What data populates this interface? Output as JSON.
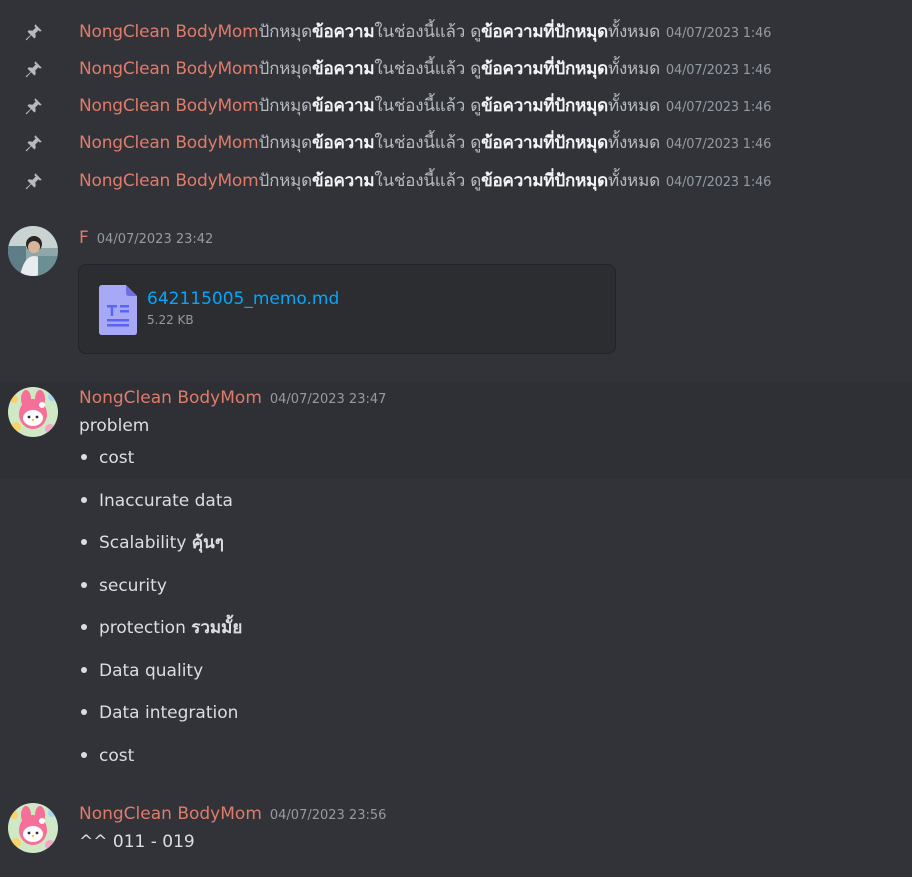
{
  "pins": [
    {
      "author": "NongClean BodyMom",
      "a": "ปักหมุด",
      "b": "ข้อความ",
      "c": "ในช่องนี้แล้ว ดู",
      "d": "ข้อความที่ปักหมุด",
      "e": "ทั้งหมด",
      "time": "04/07/2023 1:46"
    },
    {
      "author": "NongClean BodyMom",
      "a": "ปักหมุด",
      "b": "ข้อความ",
      "c": "ในช่องนี้แล้ว ดู",
      "d": "ข้อความที่ปักหมุด",
      "e": "ทั้งหมด",
      "time": "04/07/2023 1:46"
    },
    {
      "author": "NongClean BodyMom",
      "a": "ปักหมุด",
      "b": "ข้อความ",
      "c": "ในช่องนี้แล้ว ดู",
      "d": "ข้อความที่ปักหมุด",
      "e": "ทั้งหมด",
      "time": "04/07/2023 1:46"
    },
    {
      "author": "NongClean BodyMom",
      "a": "ปักหมุด",
      "b": "ข้อความ",
      "c": "ในช่องนี้แล้ว ดู",
      "d": "ข้อความที่ปักหมุด",
      "e": "ทั้งหมด",
      "time": "04/07/2023 1:46"
    },
    {
      "author": "NongClean BodyMom",
      "a": "ปักหมุด",
      "b": "ข้อความ",
      "c": "ในช่องนี้แล้ว ดู",
      "d": "ข้อความที่ปักหมุด",
      "e": "ทั้งหมด",
      "time": "04/07/2023 1:46"
    }
  ],
  "msg1": {
    "author": "F",
    "time": "04/07/2023 23:42",
    "file_name": "642115005_memo.md",
    "file_size": "5.22 KB"
  },
  "msg2": {
    "author": "NongClean BodyMom",
    "time": "04/07/2023 23:47",
    "text": "problem",
    "items": [
      {
        "text": "cost",
        "thai": ""
      },
      {
        "text": "Inaccurate data",
        "thai": ""
      },
      {
        "text": "Scalability ",
        "thai": "คุ้นๆ"
      },
      {
        "text": "security",
        "thai": ""
      },
      {
        "text": "protection ",
        "thai": "รวมมั้ย"
      },
      {
        "text": "Data quality",
        "thai": ""
      },
      {
        "text": "Data integration",
        "thai": ""
      },
      {
        "text": "cost",
        "thai": ""
      }
    ]
  },
  "msg3": {
    "author": "NongClean BodyMom",
    "time": "04/07/2023 23:56",
    "text": "^^ 011 - 019"
  },
  "colors": {
    "background": "#313338",
    "author": "#e07b6a",
    "link": "#00a8fc",
    "muted": "#949ba4"
  }
}
